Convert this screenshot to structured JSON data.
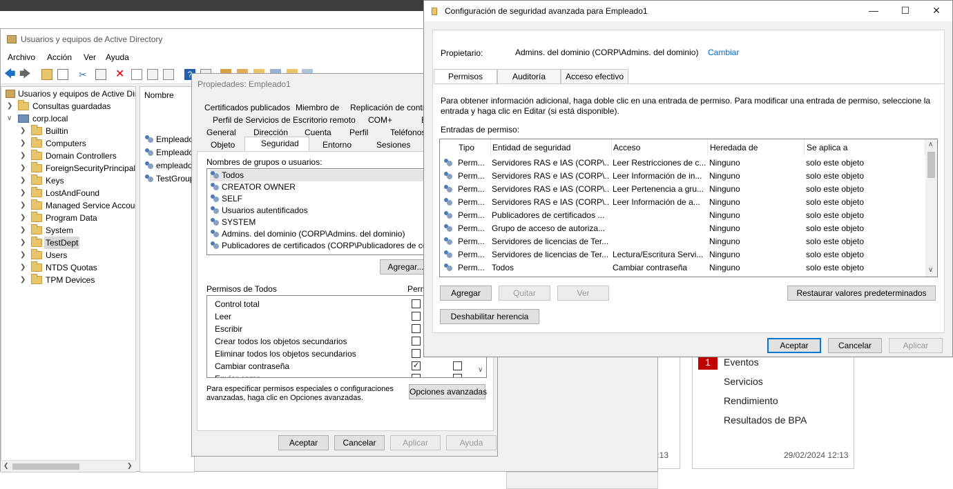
{
  "server_manager": {
    "links": [
      "Eventos",
      "Servicios",
      "Rendimiento",
      "Resultados de BPA"
    ],
    "badge": "1",
    "timestamp_left": "12:13",
    "timestamp_right": "29/02/2024 12:13"
  },
  "aduc": {
    "title": "Usuarios y equipos de Active Directory",
    "menu": [
      "Archivo",
      "Acción",
      "Ver",
      "Ayuda"
    ],
    "tree": {
      "root": "Usuarios y equipos de Active Dir",
      "saved": "Consultas guardadas",
      "domain": "corp.local",
      "items": [
        "Builtin",
        "Computers",
        "Domain Controllers",
        "ForeignSecurityPrincipals",
        "Keys",
        "LostAndFound",
        "Managed Service Accour",
        "Program Data",
        "System",
        "TestDept",
        "Users",
        "NTDS Quotas",
        "TPM Devices"
      ]
    },
    "list": {
      "header": "Nombre",
      "items": [
        "Empleado",
        "Empleado",
        "empleado",
        "TestGroup"
      ]
    }
  },
  "props": {
    "title": "Propiedades: Empleado1",
    "tabs_row1": [
      "Certificados publicados",
      "Miembro de",
      "Replicación de contras"
    ],
    "tabs_row2": [
      "Perfil de Servicios de Escritorio remoto",
      "COM+",
      "E"
    ],
    "tabs_row3": [
      "General",
      "Dirección",
      "Cuenta",
      "Perfil",
      "Teléfonos"
    ],
    "tabs_row4": [
      "Objeto",
      "Seguridad",
      "Entorno",
      "Sesiones"
    ],
    "groups_label": "Nombres de grupos o usuarios:",
    "groups": [
      "Todos",
      "CREATOR OWNER",
      "SELF",
      "Usuarios autentificados",
      "SYSTEM",
      "Admins. del dominio (CORP\\Admins. del dominio)",
      "Publicadores de certificados (CORP\\Publicadores de certificac"
    ],
    "add_button": "Agregar...",
    "perms_label": "Permisos de Todos",
    "perms_col": "Perm",
    "permissions": [
      "Control total",
      "Leer",
      "Escribir",
      "Crear todos los objetos secundarios",
      "Eliminar todos los objetos secundarios",
      "Cambiar contraseña",
      "Enviar como"
    ],
    "advanced_hint": "Para especificar permisos especiales o configuraciones avanzadas, haga clic en Opciones avanzadas.",
    "advanced_button": "Opciones avanzadas",
    "buttons": {
      "ok": "Aceptar",
      "cancel": "Cancelar",
      "apply": "Aplicar",
      "help": "Ayuda"
    }
  },
  "adv": {
    "title": "Configuración de seguridad avanzada para Empleado1",
    "owner_label": "Propietario:",
    "owner_value": "Admins. del dominio (CORP\\Admins. del dominio)",
    "change_link": "Cambiar",
    "tabs": [
      "Permisos",
      "Auditoría",
      "Acceso efectivo"
    ],
    "info": "Para obtener información adicional, haga doble clic en una entrada de permiso. Para modificar una entrada de permiso, seleccione la entrada y haga clic en Editar (si está disponible).",
    "entries_label": "Entradas de permiso:",
    "columns": [
      "Tipo",
      "Entidad de seguridad",
      "Acceso",
      "Heredada de",
      "Se aplica a"
    ],
    "rows": [
      [
        "Perm...",
        "Servidores RAS e IAS (CORP\\...",
        "Leer Restricciones de c...",
        "Ninguno",
        "solo este objeto"
      ],
      [
        "Perm...",
        "Servidores RAS e IAS (CORP\\...",
        "Leer Información de in...",
        "Ninguno",
        "solo este objeto"
      ],
      [
        "Perm...",
        "Servidores RAS e IAS (CORP\\...",
        "Leer Pertenencia a gru...",
        "Ninguno",
        "solo este objeto"
      ],
      [
        "Perm...",
        "Servidores RAS e IAS (CORP\\...",
        "Leer Información de a...",
        "Ninguno",
        "solo este objeto"
      ],
      [
        "Perm...",
        "Publicadores de certificados ...",
        "",
        "Ninguno",
        "solo este objeto"
      ],
      [
        "Perm...",
        "Grupo de acceso de autoriza...",
        "",
        "Ninguno",
        "solo este objeto"
      ],
      [
        "Perm...",
        "Servidores de licencias de Ter...",
        "",
        "Ninguno",
        "solo este objeto"
      ],
      [
        "Perm...",
        "Servidores de licencias de Ter...",
        "Lectura/Escritura Servi...",
        "Ninguno",
        "solo este objeto"
      ],
      [
        "Perm...",
        "Todos",
        "Cambiar contraseña",
        "Ninguno",
        "solo este objeto"
      ]
    ],
    "buttons": {
      "add": "Agregar",
      "remove": "Quitar",
      "view": "Ver",
      "restore": "Restaurar valores predeterminados",
      "disable_inherit": "Deshabilitar herencia",
      "ok": "Aceptar",
      "cancel": "Cancelar",
      "apply": "Aplicar"
    }
  }
}
